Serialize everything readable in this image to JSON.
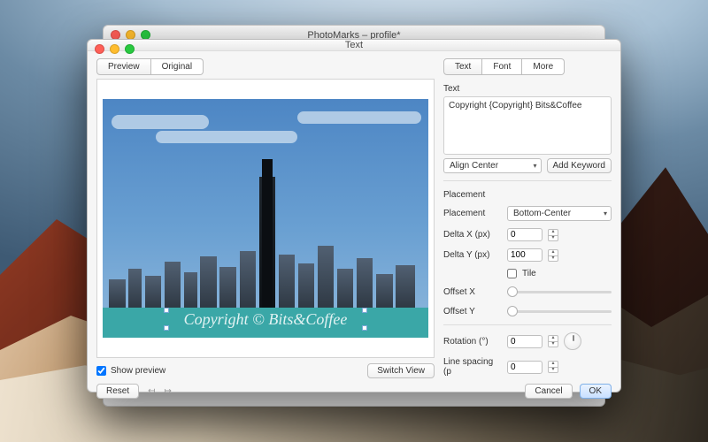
{
  "backwin": {
    "title": "PhotoMarks – profile*"
  },
  "dialog": {
    "title": "Text",
    "left": {
      "tabs": [
        "Preview",
        "Original"
      ],
      "active_tab": 0,
      "watermark": "Copyright © Bits&Coffee",
      "show_preview_label": "Show preview",
      "show_preview_checked": true,
      "switch_view": "Switch View",
      "reset": "Reset"
    },
    "right": {
      "tabs": [
        "Text",
        "Font",
        "More"
      ],
      "active_tab": 0,
      "text_label": "Text",
      "text_value": "Copyright {Copyright} Bits&Coffee",
      "align_value": "Align Center",
      "add_keyword": "Add Keyword",
      "placement_section": "Placement",
      "placement_label": "Placement",
      "placement_value": "Bottom-Center",
      "deltax_label": "Delta X (px)",
      "deltax_value": "0",
      "deltay_label": "Delta Y (px)",
      "deltay_value": "100",
      "tile_label": "Tile",
      "tile_checked": false,
      "offsetx_label": "Offset X",
      "offsety_label": "Offset Y",
      "rotation_label": "Rotation (°)",
      "rotation_value": "0",
      "lspace_label": "Line spacing (p",
      "lspace_value": "0",
      "cancel": "Cancel",
      "ok": "OK"
    }
  }
}
